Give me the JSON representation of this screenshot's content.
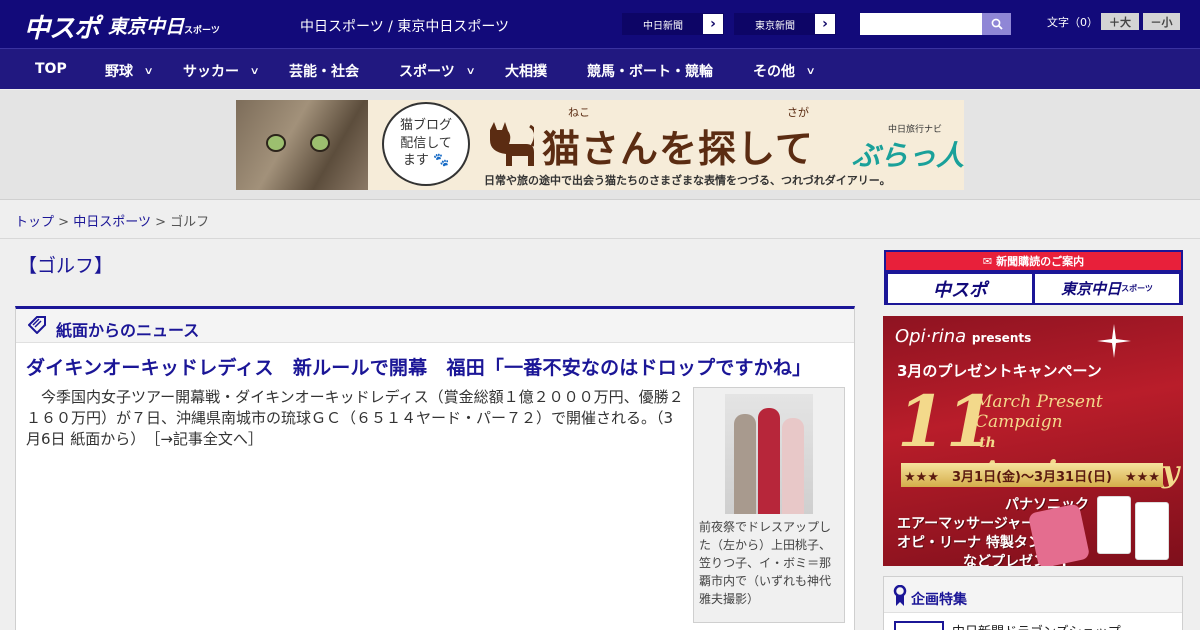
{
  "header": {
    "logo_main": "中スポ",
    "logo_sub": "東京中日",
    "logo_sub_small": "スポーツ",
    "site_names": "中日スポーツ / 東京中日スポーツ",
    "paper_links": [
      "中日新聞",
      "東京新聞"
    ],
    "arrow": "›",
    "font_size_label": "文字（0）",
    "font_bigger": "＋大",
    "font_smaller": "－小"
  },
  "nav": {
    "items": [
      {
        "label": "TOP",
        "dropdown": false
      },
      {
        "label": "野球",
        "dropdown": true
      },
      {
        "label": "サッカー",
        "dropdown": true
      },
      {
        "label": "芸能・社会",
        "dropdown": false
      },
      {
        "label": "スポーツ",
        "dropdown": true
      },
      {
        "label": "大相撲",
        "dropdown": false
      },
      {
        "label": "競馬・ボート・競輪",
        "dropdown": false
      },
      {
        "label": "その他",
        "dropdown": true
      }
    ],
    "chevron": "∨"
  },
  "ad_banner": {
    "bubble_line1": "猫ブログ",
    "bubble_line2": "配信して",
    "bubble_line3": "ます",
    "ruby_neko": "ねこ",
    "ruby_saga": "さが",
    "title": "猫さんを探して",
    "brand_small": "中日旅行ナビ",
    "brand": "ぶらっ人",
    "subtitle": "日常や旅の途中で出会う猫たちのさまざまな表情をつづる、つれづれダイアリー。"
  },
  "breadcrumb": {
    "top": "トップ",
    "section": "中日スポーツ",
    "current": "ゴルフ",
    "separator": ">"
  },
  "main": {
    "category_heading": "【ゴルフ】",
    "news_box_title": "紙面からのニュース",
    "article": {
      "title": "ダイキンオーキッドレディス　新ルールで開幕　福田「一番不安なのはドロップですかね」",
      "body": "今季国内女子ツアー開幕戦・ダイキンオーキッドレディス（賞金総額１億２０００万円、優勝２１６０万円）が７日、沖縄県南城市の琉球ＧＣ（６５１４ヤード・パー７２）で開催される。（3月6日 紙面から）",
      "more_link": "［→記事全文へ］",
      "photo_caption": "前夜祭でドレスアップした（左から）上田桃子、笠りつ子、イ・ボミ＝那覇市内で（いずれも神代雅夫撮影）"
    }
  },
  "sidebar": {
    "subscribe_label": "新聞購読のご案内",
    "subscribe_btn1": "中スポ",
    "subscribe_btn2_main": "東京中日",
    "subscribe_btn2_small": "スポーツ",
    "ad": {
      "brand": "Opi·rina",
      "presents": "presents",
      "campaign": "3月のプレゼントキャンペーン",
      "mpc": "March Present Campaign",
      "big_number": "11",
      "th": "th",
      "anniversary": "Anniversary",
      "dates": "★★★　3月1日(金)〜3月31日(日)　★★★",
      "gift_line1": "パナソニック",
      "gift_line2": "エアーマッサージャー",
      "gift_line3": "オピ・リーナ 特製タンブラー",
      "gift_line4": "などプレゼント!"
    },
    "special_title": "企画特集",
    "special_item": "中日新聞ドラゴンズショップ"
  },
  "colors": {
    "header_navy": "#120a7a",
    "nav_navy": "#211880",
    "link_blue": "#1b1697",
    "subscribe_red": "#e8203a"
  }
}
